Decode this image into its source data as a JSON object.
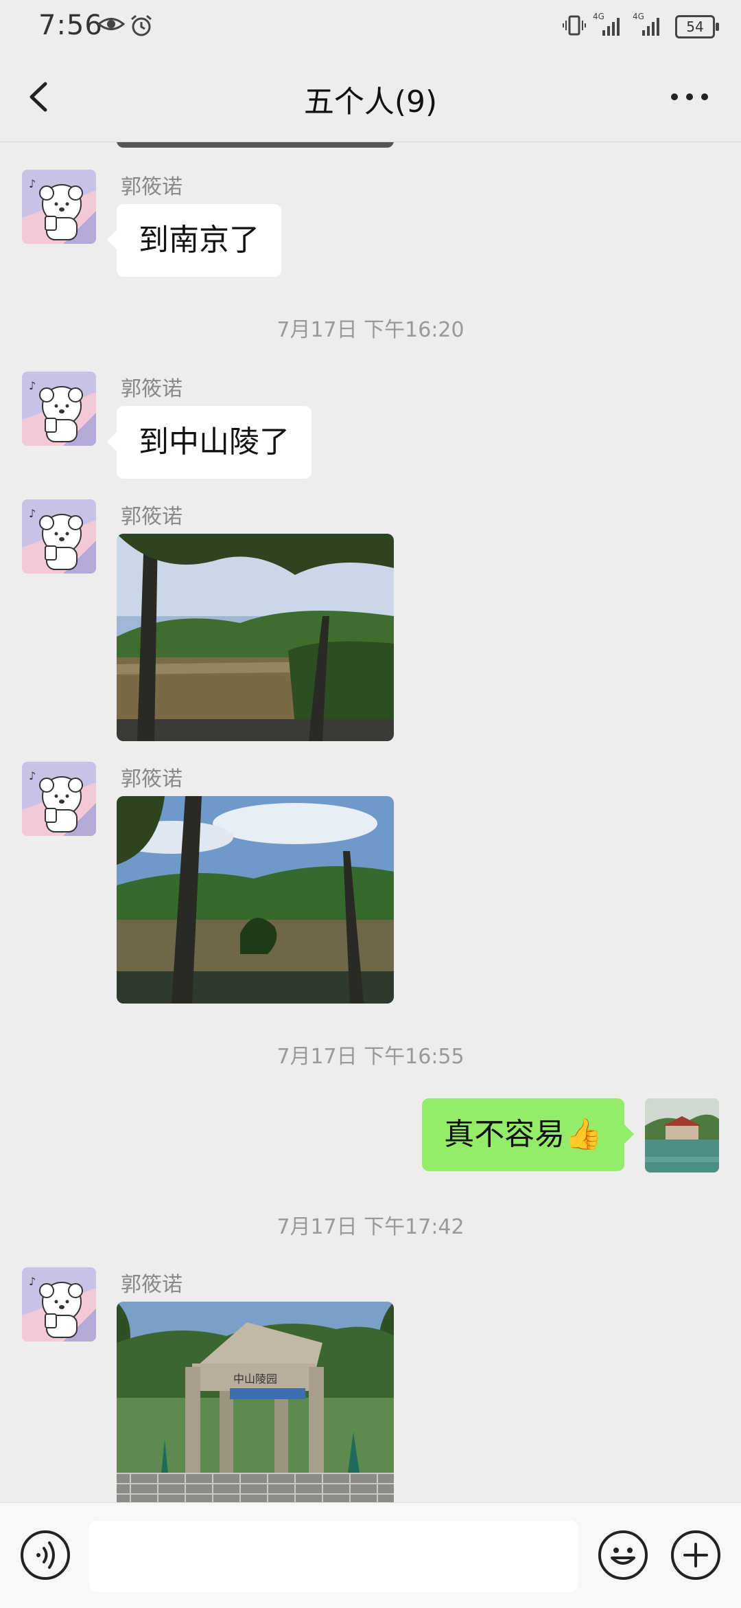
{
  "status": {
    "time": "7:56",
    "battery": "54",
    "net1": "4G",
    "net2": "4G"
  },
  "header": {
    "title": "五个人(9)"
  },
  "messages": [
    {
      "sender": "郭筱诺",
      "text": "到南京了"
    },
    {
      "timestamp": "7月17日 下午16:20"
    },
    {
      "sender": "郭筱诺",
      "text": "到中山陵了"
    },
    {
      "sender": "郭筱诺",
      "image": "lake-trees-photo"
    },
    {
      "sender": "郭筱诺",
      "image": "lake-trees-photo-2"
    },
    {
      "timestamp": "7月17日 下午16:55"
    },
    {
      "self": true,
      "text": "真不容易👍"
    },
    {
      "timestamp": "7月17日 下午17:42"
    },
    {
      "sender": "郭筱诺",
      "image": "zhongshanling-gate-photo",
      "sign_text": "中山陵园"
    }
  ],
  "icons": {
    "back": "chevron-left-icon",
    "more": "more-dots-icon",
    "voice": "voice-icon",
    "emoji": "emoji-icon",
    "plus": "plus-icon",
    "eye": "eye-icon",
    "alarm": "alarm-icon",
    "vibrate": "vibrate-icon"
  },
  "colors": {
    "bubble_self": "#95ec69",
    "bubble_other": "#ffffff",
    "background": "#ededed"
  }
}
